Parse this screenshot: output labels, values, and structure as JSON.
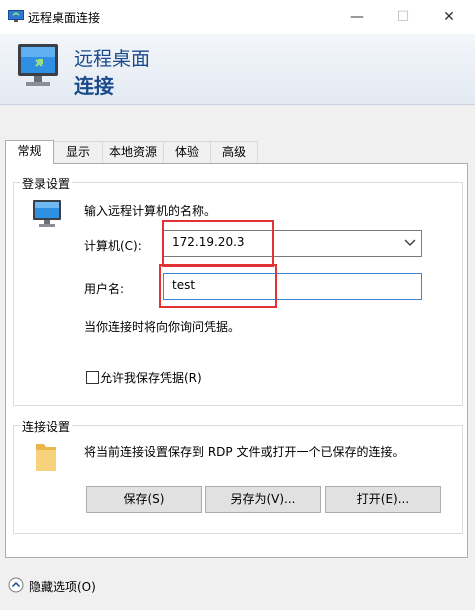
{
  "window": {
    "title": "远程桌面连接",
    "minimize_glyph": "—",
    "maximize_glyph": "☐",
    "close_glyph": "✕"
  },
  "header": {
    "line1": "远程桌面",
    "line2": "连接"
  },
  "tabs": [
    {
      "label": "常规",
      "active": true
    },
    {
      "label": "显示"
    },
    {
      "label": "本地资源"
    },
    {
      "label": "体验"
    },
    {
      "label": "高级"
    }
  ],
  "login": {
    "legend": "登录设置",
    "description": "输入远程计算机的名称。",
    "computer_label": "计算机(C):",
    "computer_value": "172.19.20.3",
    "user_label": "用户名:",
    "user_value": "test",
    "hint": "当你连接时将向你询问凭据。",
    "save_credentials_label": "允许我保存凭据(R)",
    "save_credentials_checked": false
  },
  "connection": {
    "legend": "连接设置",
    "description": "将当前连接设置保存到 RDP 文件或打开一个已保存的连接。",
    "save_button": "保存(S)",
    "saveas_button": "另存为(V)...",
    "open_button": "打开(E)..."
  },
  "footer": {
    "hide_options": "隐藏选项(O)"
  },
  "icons": {
    "app": "remote-desktop-icon",
    "banner": "remote-desktop-monitor-icon",
    "login": "computer-icon",
    "connection": "folder-icon",
    "hide": "collapse-up-icon"
  },
  "colors": {
    "accent": "#1a4a8a",
    "highlight": "#e33236",
    "focus": "#3c87d1"
  }
}
